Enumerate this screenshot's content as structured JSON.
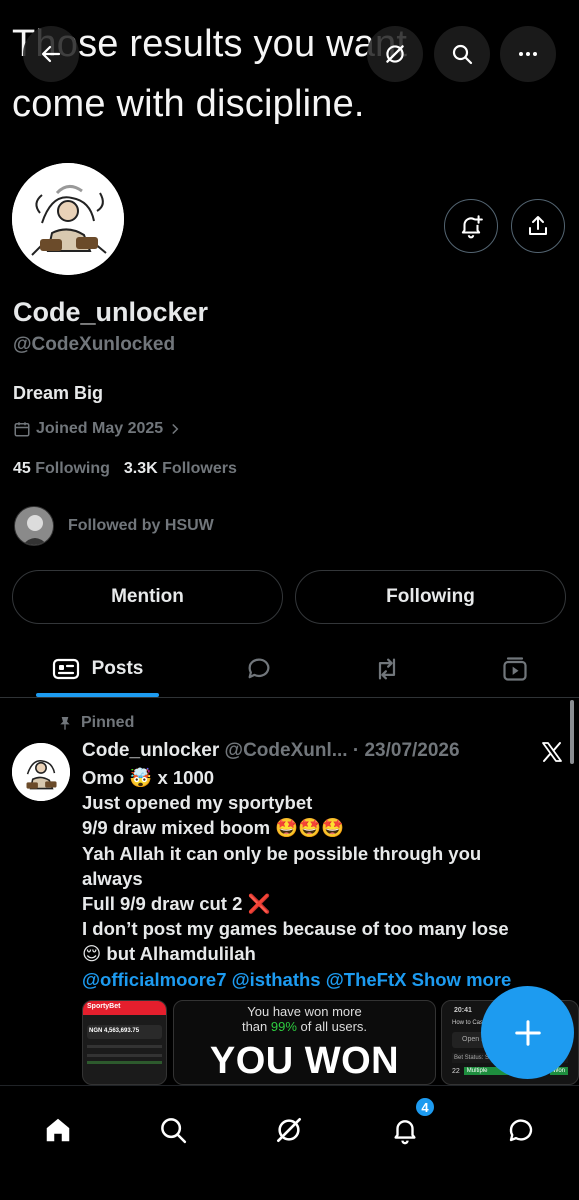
{
  "banner": {
    "line1": "Those results you want",
    "line2": "come with discipline."
  },
  "header": {
    "icons": [
      "back-arrow-icon",
      "grok-icon",
      "search-icon",
      "more-icon"
    ]
  },
  "profile": {
    "display_name": "Code_unlocker",
    "handle": "@CodeXunlocked",
    "bio": "Dream Big",
    "joined": "Joined May 2025",
    "following_count": "45",
    "following_label": "Following",
    "followers_count": "3.3K",
    "followers_label": "Followers",
    "followed_by": "Followed by HSUW",
    "actions": {
      "notify_icon": "bell-plus-icon",
      "share_icon": "share-icon"
    }
  },
  "buttons": {
    "mention": "Mention",
    "following": "Following"
  },
  "tabs": {
    "posts": "Posts"
  },
  "post": {
    "pinned_label": "Pinned",
    "author_name": "Code_unlocker",
    "author_meta": "@CodeXunl... · 23/07/2026",
    "lines": [
      "Omo 🤯 x 1000",
      "Just opened my sportybet",
      "9/9 draw mixed boom 🤩🤩🤩",
      "Yah Allah it can only be possible through you",
      "always",
      "Full 9/9 draw cut 2 ❌",
      "I don’t post my games because of too many lose",
      "😌 but Alhamdulilah"
    ],
    "mentions": "@officialmoore7 @isthaths @TheFtX",
    "show_more": "Show more",
    "media": {
      "left_brand": "SportyBet",
      "left_amount": "NGN 4,563,693.75",
      "center_line1": "You have won more",
      "center_line2_prefix": "than ",
      "center_line2_pct": "99%",
      "center_line2_suffix": " of all users.",
      "center_big": "YOU WON",
      "right_time": "20:41",
      "right_title": "How to Cashout",
      "right_btn": "Open Bet",
      "right_status": "Bet Status: Settled",
      "right_num": "22",
      "right_tag": "Multiple",
      "right_won": "Won"
    }
  },
  "bottom_nav": {
    "notif_count": "4"
  },
  "colors": {
    "accent": "#1d9bf0",
    "secondary_text": "#71767b",
    "primary_text": "#e7e9ea"
  }
}
